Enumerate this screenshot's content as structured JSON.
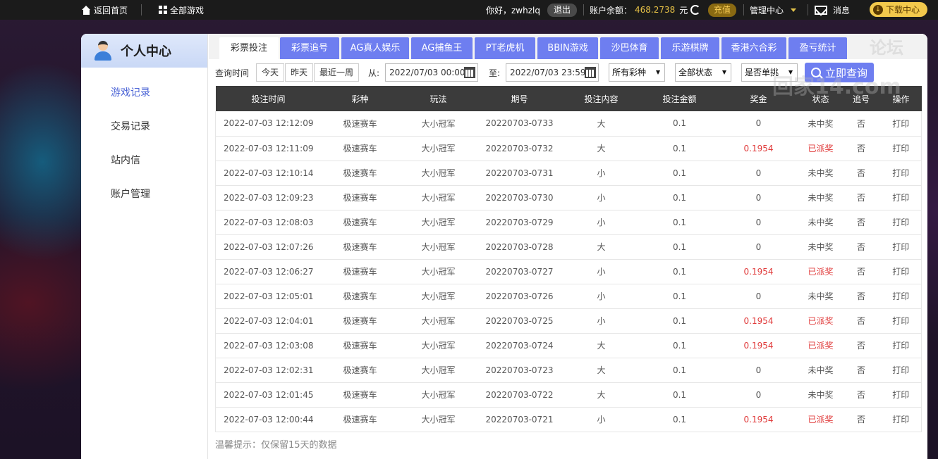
{
  "topbar": {
    "home_label": "返回首页",
    "all_games_label": "全部游戏",
    "greeting": "你好，zwhzlq",
    "logout_label": "退出",
    "balance_label": "账户余额：",
    "balance_value": "468.2738",
    "balance_unit": "元",
    "recharge_label": "充值",
    "manage_label": "管理中心",
    "messages_label": "消息",
    "download_label": "下载中心"
  },
  "sidebar": {
    "title": "个人中心",
    "items": [
      {
        "label": "游戏记录",
        "active": true
      },
      {
        "label": "交易记录",
        "active": false
      },
      {
        "label": "站内信",
        "active": false
      },
      {
        "label": "账户管理",
        "active": false
      }
    ]
  },
  "tabs": [
    {
      "label": "彩票投注",
      "active": true
    },
    {
      "label": "彩票追号",
      "active": false
    },
    {
      "label": "AG真人娱乐",
      "active": false
    },
    {
      "label": "AG捕鱼王",
      "active": false
    },
    {
      "label": "PT老虎机",
      "active": false
    },
    {
      "label": "BBIN游戏",
      "active": false
    },
    {
      "label": "沙巴体育",
      "active": false
    },
    {
      "label": "乐游棋牌",
      "active": false
    },
    {
      "label": "香港六合彩",
      "active": false
    },
    {
      "label": "盈亏统计",
      "active": false
    }
  ],
  "filters": {
    "time_label": "查询时间",
    "quick": [
      "今天",
      "昨天",
      "最近一周"
    ],
    "from_label": "从:",
    "from_value": "2022/07/03 00:00",
    "to_label": "至:",
    "to_value": "2022/07/03 23:59",
    "lottery_type": "所有彩种",
    "status": "全部状态",
    "single": "是否单挑",
    "query_label": "立即查询"
  },
  "table": {
    "headers": [
      "投注时间",
      "彩种",
      "玩法",
      "期号",
      "投注内容",
      "投注金额",
      "奖金",
      "状态",
      "追号",
      "操作"
    ],
    "rows": [
      [
        "2022-07-03 12:12:09",
        "极速赛车",
        "大小冠军",
        "20220703-0733",
        "大",
        "0.1",
        "0",
        "未中奖",
        "否",
        "打印"
      ],
      [
        "2022-07-03 12:11:09",
        "极速赛车",
        "大小冠军",
        "20220703-0732",
        "大",
        "0.1",
        "0.1954",
        "已派奖",
        "否",
        "打印"
      ],
      [
        "2022-07-03 12:10:14",
        "极速赛车",
        "大小冠军",
        "20220703-0731",
        "小",
        "0.1",
        "0",
        "未中奖",
        "否",
        "打印"
      ],
      [
        "2022-07-03 12:09:23",
        "极速赛车",
        "大小冠军",
        "20220703-0730",
        "小",
        "0.1",
        "0",
        "未中奖",
        "否",
        "打印"
      ],
      [
        "2022-07-03 12:08:03",
        "极速赛车",
        "大小冠军",
        "20220703-0729",
        "小",
        "0.1",
        "0",
        "未中奖",
        "否",
        "打印"
      ],
      [
        "2022-07-03 12:07:26",
        "极速赛车",
        "大小冠军",
        "20220703-0728",
        "大",
        "0.1",
        "0",
        "未中奖",
        "否",
        "打印"
      ],
      [
        "2022-07-03 12:06:27",
        "极速赛车",
        "大小冠军",
        "20220703-0727",
        "小",
        "0.1",
        "0.1954",
        "已派奖",
        "否",
        "打印"
      ],
      [
        "2022-07-03 12:05:01",
        "极速赛车",
        "大小冠军",
        "20220703-0726",
        "小",
        "0.1",
        "0",
        "未中奖",
        "否",
        "打印"
      ],
      [
        "2022-07-03 12:04:01",
        "极速赛车",
        "大小冠军",
        "20220703-0725",
        "小",
        "0.1",
        "0.1954",
        "已派奖",
        "否",
        "打印"
      ],
      [
        "2022-07-03 12:03:08",
        "极速赛车",
        "大小冠军",
        "20220703-0724",
        "大",
        "0.1",
        "0.1954",
        "已派奖",
        "否",
        "打印"
      ],
      [
        "2022-07-03 12:02:31",
        "极速赛车",
        "大小冠军",
        "20220703-0723",
        "大",
        "0.1",
        "0",
        "未中奖",
        "否",
        "打印"
      ],
      [
        "2022-07-03 12:01:45",
        "极速赛车",
        "大小冠军",
        "20220703-0722",
        "大",
        "0.1",
        "0",
        "未中奖",
        "否",
        "打印"
      ],
      [
        "2022-07-03 12:00:44",
        "极速赛车",
        "大小冠军",
        "20220703-0721",
        "小",
        "0.1",
        "0.1954",
        "已派奖",
        "否",
        "打印"
      ]
    ]
  },
  "tip": "温馨提示：仅保留15天的数据",
  "watermark": {
    "line1": "论坛",
    "line2": "回家14.com"
  },
  "colors": {
    "accent": "#6e7ef0",
    "header_dark": "#3b3b3b",
    "win_red": "#e03a3a",
    "balance_gold": "#e7c247",
    "download_yellow": "#f2c94c"
  }
}
